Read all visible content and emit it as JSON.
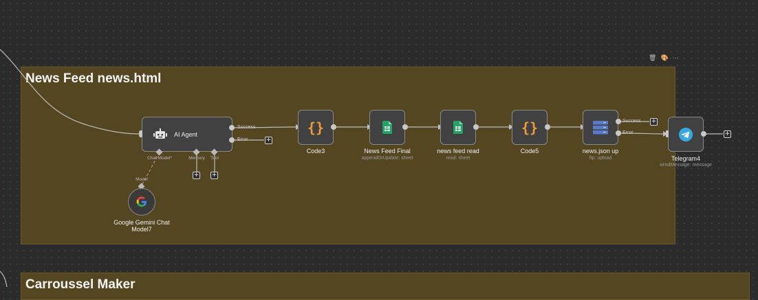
{
  "canvas": {
    "sticky_main": {
      "title": "News Feed news.html",
      "color": "#534621"
    },
    "sticky_second": {
      "title": "Carroussel Maker"
    },
    "sticky_tools": {
      "delete": "🗑",
      "color": "🎨",
      "more": "···"
    }
  },
  "nodes": {
    "ai_agent": {
      "label": "AI Agent",
      "out_success": "Success",
      "out_error": "Error",
      "sub_chat_model": "Chat Model*",
      "sub_memory": "Memory",
      "sub_tool": "Tool"
    },
    "gemini": {
      "label_line1": "Google Gemini Chat",
      "label_line2": "Model7",
      "port_label": "Model"
    },
    "code3": {
      "label": "Code3"
    },
    "news_feed_final": {
      "label": "News Feed Final",
      "subtitle": "appendOrUpdate: sheet"
    },
    "news_feed_read": {
      "label": "news feed read",
      "subtitle": "read: sheet"
    },
    "code5": {
      "label": "Code5"
    },
    "news_json_up": {
      "label": "news.json up",
      "subtitle": "ftp: upload",
      "out_success": "Success",
      "out_error": "Error"
    },
    "telegram4": {
      "label": "Telegram4",
      "subtitle": "sendMessage: message"
    }
  },
  "icons": {
    "code": "{}",
    "plus": "+"
  },
  "colors": {
    "accent_code": "#f29b3a",
    "sheets_green": "#21a464",
    "ftp_blue": "#5b79c9",
    "telegram_blue": "#37a9e2"
  }
}
